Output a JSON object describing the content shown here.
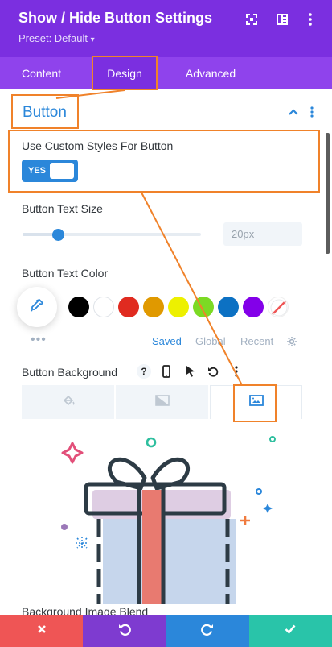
{
  "header": {
    "title": "Show / Hide Button Settings",
    "preset": "Preset: Default",
    "preset_caret": "▾",
    "icons": [
      "expand-icon",
      "sidebar-toggle-icon",
      "more-vert-icon"
    ]
  },
  "tabs": [
    {
      "label": "Content",
      "active": false
    },
    {
      "label": "Design",
      "active": true
    },
    {
      "label": "Advanced",
      "active": false
    }
  ],
  "section": {
    "title": "Button",
    "collapse_glyph": "^"
  },
  "custom_styles": {
    "label": "Use Custom Styles For Button",
    "toggle_label": "YES",
    "enabled": true
  },
  "text_size": {
    "label": "Button Text Size",
    "placeholder": "20px",
    "slider_fraction": 0.2
  },
  "text_color": {
    "label": "Button Text Color",
    "swatches": [
      "#000000",
      "#ffffff",
      "#e02b20",
      "#e09900",
      "#edf000",
      "#7cda24",
      "#0c71c3",
      "#8300e9",
      "transparent"
    ],
    "more": "•••",
    "palette_tabs": [
      {
        "label": "Saved",
        "active": true
      },
      {
        "label": "Global",
        "active": false
      },
      {
        "label": "Recent",
        "active": false
      }
    ]
  },
  "background": {
    "label": "Button Background",
    "icons": [
      "help-icon",
      "phone-icon",
      "cursor-icon",
      "undo-icon",
      "more-vert-icon"
    ],
    "help_glyph": "?",
    "tabs": [
      {
        "icon": "paint-bucket-icon",
        "active": false
      },
      {
        "icon": "gradient-icon",
        "active": false
      },
      {
        "icon": "image-icon",
        "active": true
      }
    ]
  },
  "blend": {
    "label": "Background Image Blend"
  },
  "footer": [
    {
      "action": "cancel",
      "glyph": "✕",
      "color": "#ef5555"
    },
    {
      "action": "undo",
      "glyph": "↺",
      "color": "#7e3bd0"
    },
    {
      "action": "redo",
      "glyph": "↻",
      "color": "#2b87da"
    },
    {
      "action": "save",
      "glyph": "✓",
      "color": "#29c4a9"
    }
  ],
  "colors": {
    "header": "#7b2fe0",
    "tabs_bar": "#8f43ec",
    "accent_blue": "#2b87da",
    "annotation_orange": "#f0822a"
  }
}
